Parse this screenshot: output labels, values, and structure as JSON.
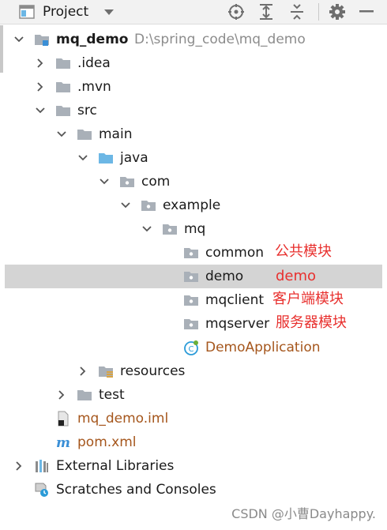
{
  "toolbar": {
    "title": "Project",
    "icons": [
      "project-view-icon",
      "dropdown-icon",
      "locate-icon",
      "expand-all-icon",
      "collapse-all-icon",
      "gear-icon",
      "minimize-icon"
    ]
  },
  "tree": {
    "root": {
      "name": "mq_demo",
      "path": "D:\\spring_code\\mq_demo"
    },
    "idea": ".idea",
    "mvn": ".mvn",
    "src": "src",
    "main": "main",
    "java": "java",
    "com": "com",
    "example": "example",
    "mq": "mq",
    "common": "common",
    "demo": "demo",
    "mqclient": "mqclient",
    "mqserver": "mqserver",
    "demo_app": "DemoApplication",
    "resources": "resources",
    "test": "test",
    "iml": "mq_demo.iml",
    "pom": "pom.xml",
    "ext_libs": "External Libraries",
    "scratches": "Scratches and Consoles"
  },
  "annotations": {
    "common": "公共模块",
    "demo": "demo",
    "mqclient": "客户端模块",
    "mqserver": "服务器模块"
  },
  "watermark": "CSDN @小曹Dayhappy.",
  "colors": {
    "folder": "#a9b0b8",
    "source_folder": "#6cb7e5",
    "annotation": "#e8302e",
    "selection": "#d4d4d4",
    "file_orange": "#a5561c"
  }
}
